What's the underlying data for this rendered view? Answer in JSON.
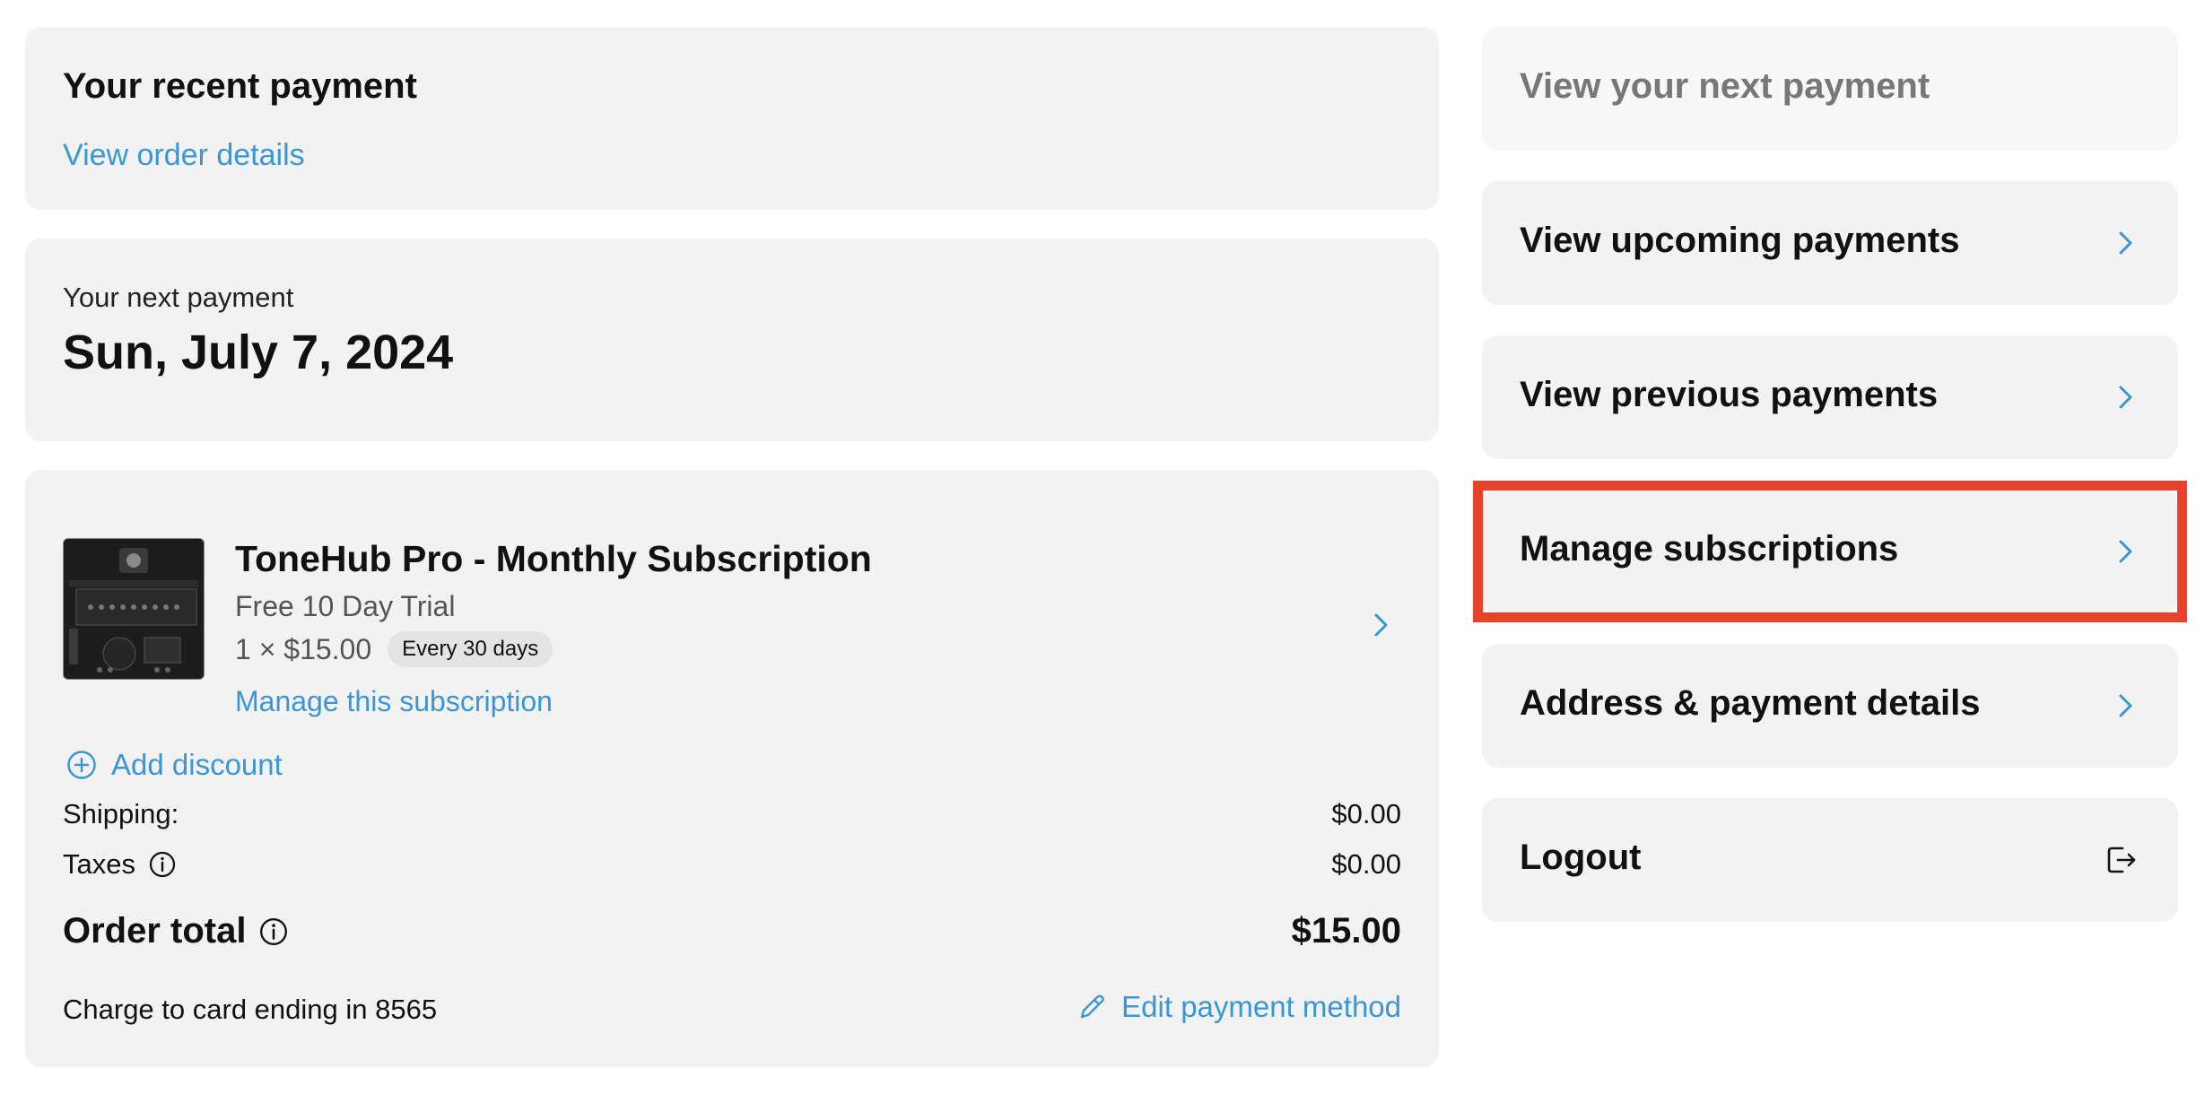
{
  "recent_payment": {
    "title": "Your recent payment",
    "link": "View order details"
  },
  "next_payment": {
    "label": "Your next payment",
    "date": "Sun, July 7, 2024"
  },
  "subscription": {
    "product_name": "ToneHub Pro - Monthly Subscription",
    "trial": "Free 10 Day Trial",
    "quantity_price": "1 × $15.00",
    "frequency_badge": "Every 30 days",
    "manage_link": "Manage this subscription",
    "add_discount": "Add discount",
    "shipping_label": "Shipping:",
    "shipping_value": "$0.00",
    "taxes_label": "Taxes",
    "taxes_value": "$0.00",
    "total_label": "Order total",
    "total_value": "$15.00",
    "card_text": "Charge to card ending in 8565",
    "edit_payment": "Edit payment method"
  },
  "sidebar": {
    "items": [
      {
        "label": "View your next payment",
        "disabled": true
      },
      {
        "label": "View upcoming payments"
      },
      {
        "label": "View previous payments"
      },
      {
        "label": "Manage subscriptions",
        "highlighted": true
      },
      {
        "label": "Address & payment details"
      },
      {
        "label": "Logout",
        "icon": "logout-icon"
      }
    ]
  },
  "colors": {
    "link": "#3a97d4",
    "card_bg": "#f2f2f2",
    "highlight": "#e8422a",
    "disabled_text": "#777777"
  }
}
